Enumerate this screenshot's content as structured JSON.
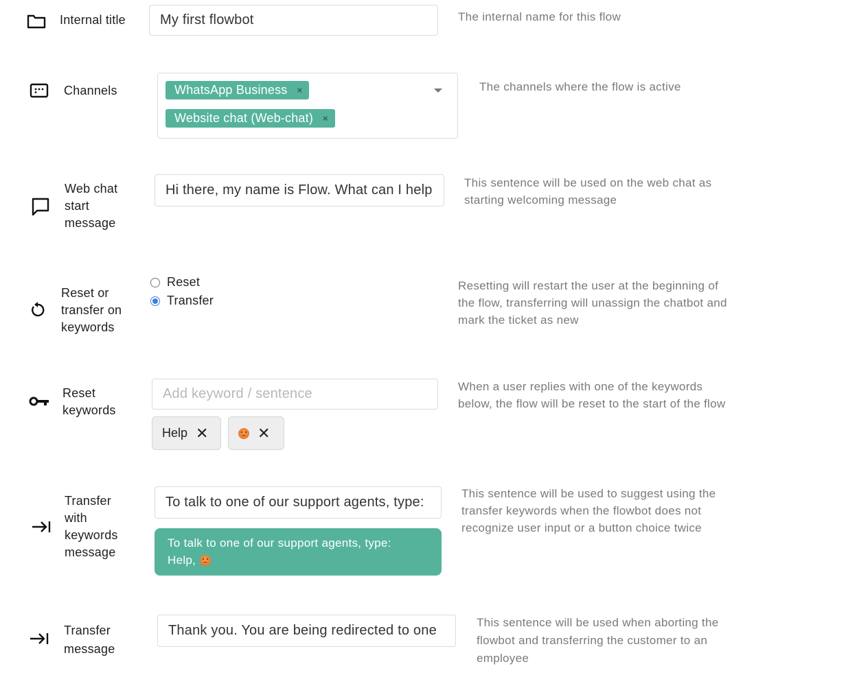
{
  "internal_title": {
    "label": "Internal title",
    "value": "My first flowbot",
    "help": "The internal name for this flow"
  },
  "channels": {
    "label": "Channels",
    "selected": [
      "WhatsApp Business",
      "Website chat (Web-chat)"
    ],
    "remove_symbol": "×",
    "help": "The channels where the flow is active"
  },
  "web_chat_start": {
    "label_lines": [
      "Web chat",
      "start",
      "message"
    ],
    "value": "Hi there, my name is Flow. What can I help",
    "help_lines": [
      "This sentence will be used on the web chat as",
      "starting welcoming message"
    ]
  },
  "reset_or_transfer": {
    "label_lines": [
      "Reset or",
      "transfer on",
      "keywords"
    ],
    "options": [
      "Reset",
      "Transfer"
    ],
    "selected": "Transfer",
    "help_lines": [
      "Resetting will restart the user at the beginning of",
      "the flow, transferring will unassign the chatbot and",
      "mark the ticket as new"
    ]
  },
  "reset_keywords": {
    "label_lines": [
      "Reset",
      "keywords"
    ],
    "placeholder": "Add keyword / sentence",
    "keywords": [
      "Help"
    ],
    "remove_symbol": "✕",
    "help_lines": [
      "When a user replies with one of the keywords",
      "below, the flow will be reset to the start of the flow"
    ]
  },
  "transfer_keywords_message": {
    "label_lines": [
      "Transfer",
      "with",
      "keywords",
      "message"
    ],
    "value": "To talk to one of our support agents, type:",
    "preview_lines": [
      "To talk to one of our support agents, type:",
      "Help,"
    ],
    "help_lines": [
      "This sentence will be used to suggest using the",
      "transfer keywords when the flowbot does not",
      "recognize user input or a button choice twice"
    ]
  },
  "transfer_message": {
    "label_lines": [
      "Transfer",
      "message"
    ],
    "value": "Thank you. You are being redirected to one",
    "help_lines": [
      "This sentence will be used when aborting the",
      "flowbot and transferring the customer to an",
      "employee"
    ]
  },
  "colors": {
    "accent": "#55b39b",
    "radio_selected": "#3f7fe0",
    "help_text": "#7a7a7a"
  },
  "icons": [
    "folder-icon",
    "channels-icon",
    "chat-bubble-icon",
    "reset-icon",
    "key-icon",
    "transfer-arrow-icon"
  ]
}
